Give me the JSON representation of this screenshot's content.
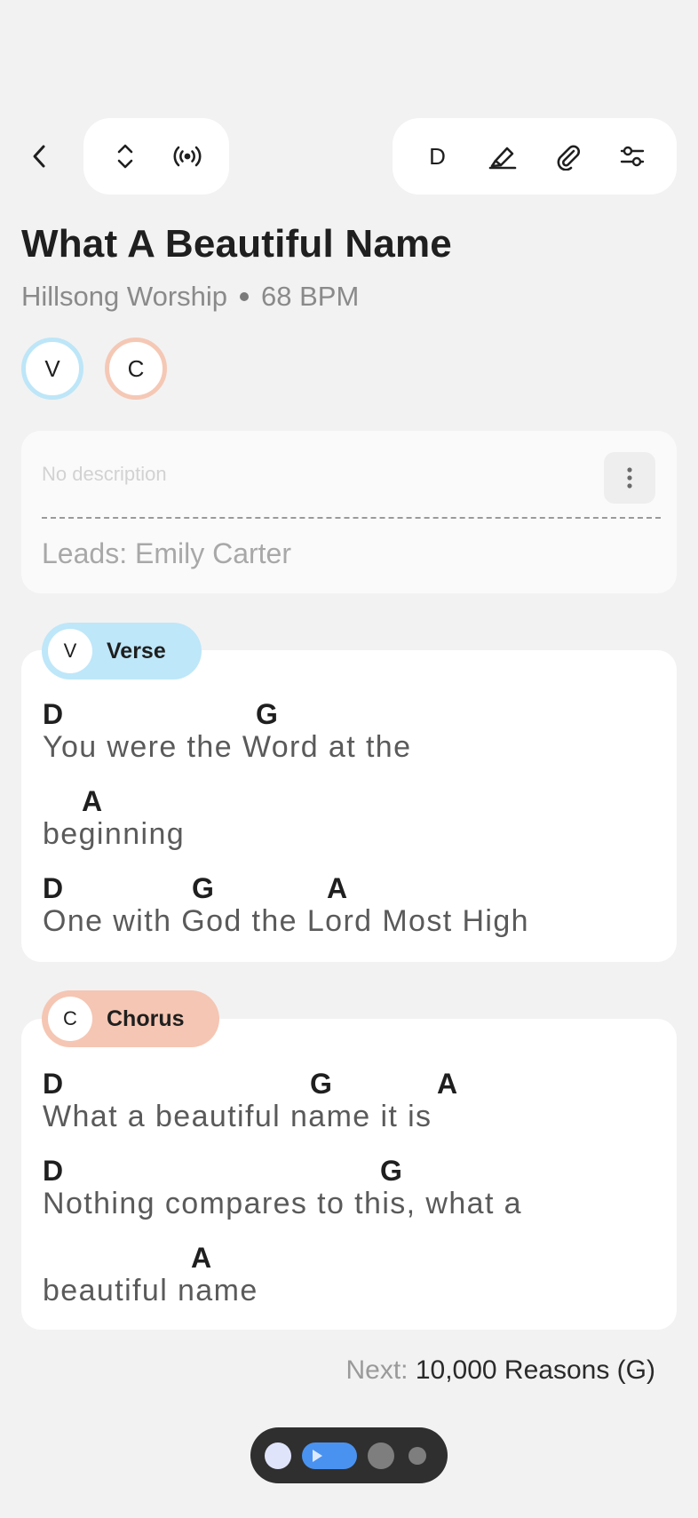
{
  "toolbar": {
    "key_label": "D"
  },
  "song": {
    "title": "What A Beautiful Name",
    "artist": "Hillsong Worship",
    "tempo": "68 BPM"
  },
  "section_chips": [
    {
      "letter": "V",
      "color": "#bde6f8"
    },
    {
      "letter": "C",
      "color": "#f5c8b5"
    }
  ],
  "description": {
    "placeholder": "No description",
    "leads": "Leads: Emily Carter"
  },
  "sections": [
    {
      "tag_letter": "V",
      "name": "Verse",
      "color": "#bee7f9",
      "lines": [
        {
          "chords": [
            "D",
            "G"
          ],
          "lyric": "You were the Word at the"
        },
        {
          "chords": [
            "A"
          ],
          "lyric": "beginning"
        },
        {
          "chords": [
            "D",
            "G",
            "A"
          ],
          "lyric": "One with God the Lord Most High"
        }
      ]
    },
    {
      "tag_letter": "C",
      "name": "Chorus",
      "color": "#f5c6b3",
      "lines": [
        {
          "chords": [
            "D",
            "G",
            "A"
          ],
          "lyric": "What a beautiful name it is"
        },
        {
          "chords": [
            "D",
            "G"
          ],
          "lyric": "Nothing compares to this, what a"
        },
        {
          "chords": [
            "A"
          ],
          "lyric": "beautiful name"
        }
      ]
    }
  ],
  "next": {
    "label": "Next:",
    "value": "10,000 Reasons (G)"
  },
  "player": {
    "accent_color": "#4a92f0"
  }
}
